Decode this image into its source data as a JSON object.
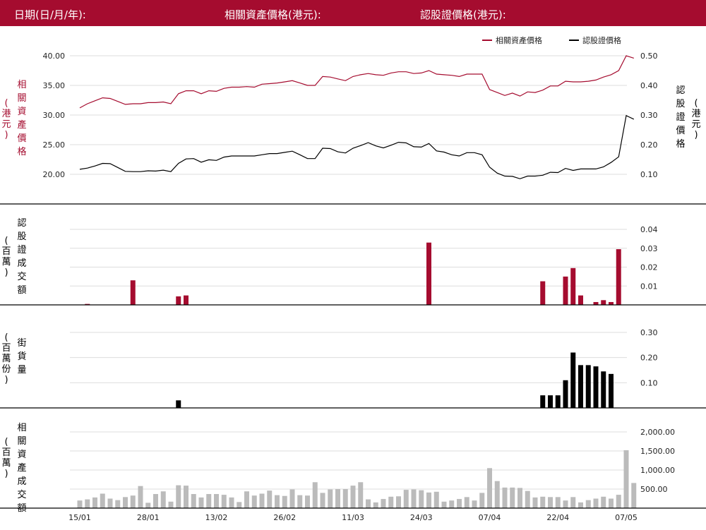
{
  "header": {
    "date_label": "日期(日/月/年):",
    "underlying_label": "相關資產價格(港元):",
    "warrant_label": "認股證價格(港元):"
  },
  "colors": {
    "header_bg": "#a50c2f",
    "underlying": "#a50c2f",
    "warrant": "#000000",
    "turnover_bar": "#bbbbbb",
    "grid": "#dddddd"
  },
  "chart_data": [
    {
      "type": "line",
      "legend": [
        "相關資產價格",
        "認股證價格"
      ],
      "legend_position": "top-right",
      "left_axis_label": "相關資產價格",
      "left_axis_unit": "(港元)",
      "right_axis_label": "認股證價格",
      "right_axis_unit": "(港元)",
      "y_left_ticks": [
        "40.00",
        "35.00",
        "30.00",
        "25.00",
        "20.00"
      ],
      "y_right_ticks": [
        "0.50",
        "0.40",
        "0.30",
        "0.20",
        "0.10"
      ],
      "y_left_range": [
        17.5,
        40.0
      ],
      "y_right_range": [
        0.05,
        0.5
      ],
      "series": [
        {
          "name": "相關資產價格",
          "values": [
            31.2,
            31.9,
            32.4,
            32.9,
            32.8,
            32.3,
            31.8,
            31.9,
            31.9,
            32.1,
            32.1,
            32.2,
            31.9,
            33.6,
            34.1,
            34.1,
            33.6,
            34.1,
            34.0,
            34.5,
            34.7,
            34.7,
            34.8,
            34.7,
            35.2,
            35.3,
            35.4,
            35.6,
            35.8,
            35.4,
            35.0,
            35.0,
            36.5,
            36.4,
            36.1,
            35.8,
            36.5,
            36.8,
            37.0,
            36.8,
            36.7,
            37.1,
            37.3,
            37.3,
            37.0,
            37.1,
            37.5,
            36.9,
            36.8,
            36.7,
            36.5,
            36.9,
            36.9,
            36.9,
            34.3,
            33.8,
            33.3,
            33.7,
            33.2,
            33.9,
            33.8,
            34.2,
            34.9,
            34.9,
            35.7,
            35.6,
            35.6,
            35.7,
            35.9,
            36.4,
            36.8,
            37.5,
            40.0,
            39.6
          ]
        },
        {
          "name": "認股證價格",
          "values": [
            0.117,
            0.121,
            0.128,
            0.137,
            0.136,
            0.123,
            0.11,
            0.109,
            0.109,
            0.112,
            0.111,
            0.114,
            0.109,
            0.137,
            0.152,
            0.153,
            0.141,
            0.149,
            0.147,
            0.158,
            0.162,
            0.162,
            0.162,
            0.162,
            0.166,
            0.17,
            0.17,
            0.174,
            0.178,
            0.166,
            0.153,
            0.153,
            0.188,
            0.187,
            0.176,
            0.172,
            0.188,
            0.197,
            0.207,
            0.196,
            0.189,
            0.198,
            0.208,
            0.206,
            0.193,
            0.192,
            0.204,
            0.179,
            0.175,
            0.166,
            0.162,
            0.173,
            0.173,
            0.166,
            0.124,
            0.104,
            0.094,
            0.093,
            0.085,
            0.094,
            0.094,
            0.097,
            0.107,
            0.106,
            0.12,
            0.113,
            0.118,
            0.118,
            0.118,
            0.125,
            0.14,
            0.159,
            0.298,
            0.286
          ]
        }
      ]
    },
    {
      "type": "bar",
      "axis_label": "認股證成交額",
      "axis_unit": "(百萬)",
      "y_ticks": [
        "0.04",
        "0.03",
        "0.02",
        "0.01"
      ],
      "y_range": [
        0,
        0.04
      ],
      "values": [
        0,
        0.0005,
        0,
        0,
        0,
        0,
        0,
        0.013,
        0,
        0,
        0,
        0,
        0,
        0.0045,
        0.005,
        0,
        0,
        0,
        0,
        0,
        0,
        0,
        0,
        0,
        0,
        0,
        0,
        0,
        0,
        0,
        0,
        0,
        0,
        0,
        0,
        0,
        0,
        0,
        0,
        0,
        0,
        0,
        0,
        0,
        0,
        0,
        0.033,
        0,
        0,
        0,
        0,
        0,
        0,
        0,
        0,
        0,
        0,
        0,
        0,
        0,
        0,
        0.0125,
        0,
        0,
        0.015,
        0.0195,
        0.005,
        0,
        0.0015,
        0.0025,
        0.0015,
        0.0295,
        0,
        0
      ]
    },
    {
      "type": "bar",
      "axis_label": "街貨量",
      "axis_unit": "(百萬份)",
      "y_ticks": [
        "0.30",
        "0.20",
        "0.10"
      ],
      "y_range": [
        0,
        0.3
      ],
      "values": [
        0,
        0,
        0,
        0,
        0,
        0,
        0,
        0,
        0,
        0,
        0,
        0,
        0,
        0.03,
        0,
        0,
        0,
        0,
        0,
        0,
        0,
        0,
        0,
        0,
        0,
        0,
        0,
        0,
        0,
        0,
        0,
        0,
        0,
        0,
        0,
        0,
        0,
        0,
        0,
        0,
        0,
        0,
        0,
        0,
        0,
        0,
        0,
        0,
        0,
        0,
        0,
        0,
        0,
        0,
        0,
        0,
        0,
        0,
        0,
        0,
        0,
        0.05,
        0.05,
        0.05,
        0.11,
        0.22,
        0.17,
        0.17,
        0.165,
        0.145,
        0.135,
        0,
        0,
        0
      ]
    },
    {
      "type": "bar",
      "axis_label": "相關資產成交額",
      "axis_unit": "(百萬)",
      "y_ticks": [
        "2,000.00",
        "1,500.00",
        "1,000.00",
        "500.00"
      ],
      "y_range": [
        0,
        2000
      ],
      "values": [
        200,
        230,
        280,
        380,
        250,
        210,
        290,
        330,
        580,
        140,
        370,
        440,
        170,
        600,
        590,
        370,
        280,
        370,
        370,
        350,
        280,
        160,
        440,
        330,
        380,
        460,
        340,
        320,
        490,
        340,
        330,
        680,
        400,
        490,
        500,
        500,
        590,
        680,
        230,
        150,
        240,
        300,
        310,
        480,
        490,
        470,
        410,
        430,
        170,
        200,
        240,
        290,
        200,
        400,
        1050,
        710,
        540,
        540,
        530,
        450,
        280,
        300,
        290,
        290,
        200,
        290,
        150,
        210,
        250,
        300,
        250,
        350,
        1520,
        660
      ],
      "x_tick_labels": [
        "15/01",
        "28/01",
        "13/02",
        "26/02",
        "11/03",
        "24/03",
        "07/04",
        "22/04",
        "07/05"
      ],
      "x_tick_index": [
        0,
        9,
        18,
        27,
        36,
        45,
        54,
        63,
        72
      ]
    }
  ]
}
